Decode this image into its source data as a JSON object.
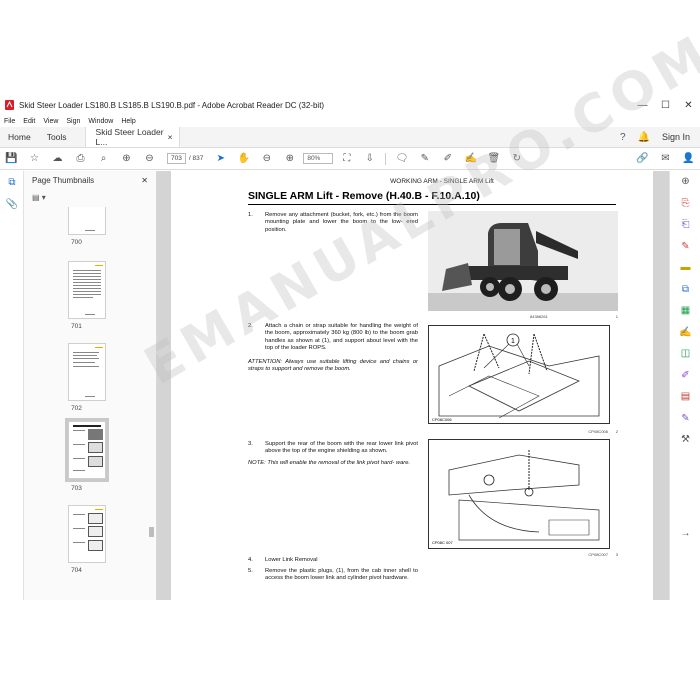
{
  "window": {
    "title": "Skid Steer Loader LS180.B LS185.B LS190.B.pdf - Adobe Acrobat Reader DC (32-bit)",
    "controls": [
      "—",
      "☐",
      "✕"
    ]
  },
  "menu": [
    "File",
    "Edit",
    "View",
    "Sign",
    "Window",
    "Help"
  ],
  "tabs": {
    "home": "Home",
    "tools": "Tools",
    "doc": "Skid Steer Loader L...",
    "close": "×",
    "signin": "Sign In"
  },
  "toolbar": {
    "page_current": "703",
    "page_total": "/ 837",
    "zoom": "80%"
  },
  "panel": {
    "title": "Page Thumbnails",
    "close": "✕",
    "thumbnails": [
      {
        "label": "700"
      },
      {
        "label": "701"
      },
      {
        "label": "702"
      },
      {
        "label": "703"
      },
      {
        "label": "704"
      }
    ]
  },
  "page": {
    "running_header": "WORKING ARM - SINGLE ARM Lift",
    "heading": "SINGLE ARM Lift - Remove (H.40.B - F.10.A.10)",
    "steps": [
      {
        "num": "1.",
        "text": "Remove any attachment (bucket, fork, etc.) from the boom mounting plate and lower the boom to the low- ered position."
      },
      {
        "num": "2.",
        "text": "Attach a chain or strap suitable for handling the weight of the boom, approximately 360 kg (800 lb) to the boom grab handles as shown at (1), and support about level with the top of the loader ROPS."
      },
      {
        "num": "3.",
        "text": "Support the rear of the boom with the rear lower link pivot above the top of the engine shielding as shown."
      },
      {
        "num": "4.",
        "text": "Lower Link Removal"
      },
      {
        "num": "5.",
        "text": "Remove the plastic plugs, (1), from the cab inner shell to access the boom lower link and cylinder pivot hardware."
      }
    ],
    "attention": "ATTENTION: Always use suitable lifting device and chains or straps to support and remove the boom.",
    "note": "NOTE: This will enable the removal of the link pivot hard- ware.",
    "figures": [
      {
        "code": "84388261",
        "num": "1"
      },
      {
        "code": "CP08C006",
        "num": "2",
        "inner": "CP08C006"
      },
      {
        "code": "CP08C007",
        "num": "3",
        "inner": "CP08C 007"
      }
    ],
    "callout": "1"
  },
  "watermark": "EMANUALPRO.COM",
  "colors": {
    "accent": "#1a6fd1",
    "doc_background": "#d4d4d4",
    "right_rail_icons": [
      "#d13b3b",
      "#7a55c7",
      "#d13b3b",
      "#c9a300",
      "#2f6fd6",
      "#1a9e4a",
      "#d13b3b",
      "#1a9e4a",
      "#8a45c9",
      "#c0392b",
      "#7a55c7",
      "#1a6fd1",
      "#555555"
    ]
  },
  "icons": {
    "right_rail": [
      "zoom-icon",
      "export-pdf-icon",
      "create-pdf-icon",
      "edit-pdf-icon",
      "comment-icon",
      "combine-icon",
      "organize-icon",
      "fill-sign-icon",
      "compress-icon",
      "protect-icon",
      "sign-icon",
      "more-tools-icon",
      "settings-icon"
    ]
  }
}
